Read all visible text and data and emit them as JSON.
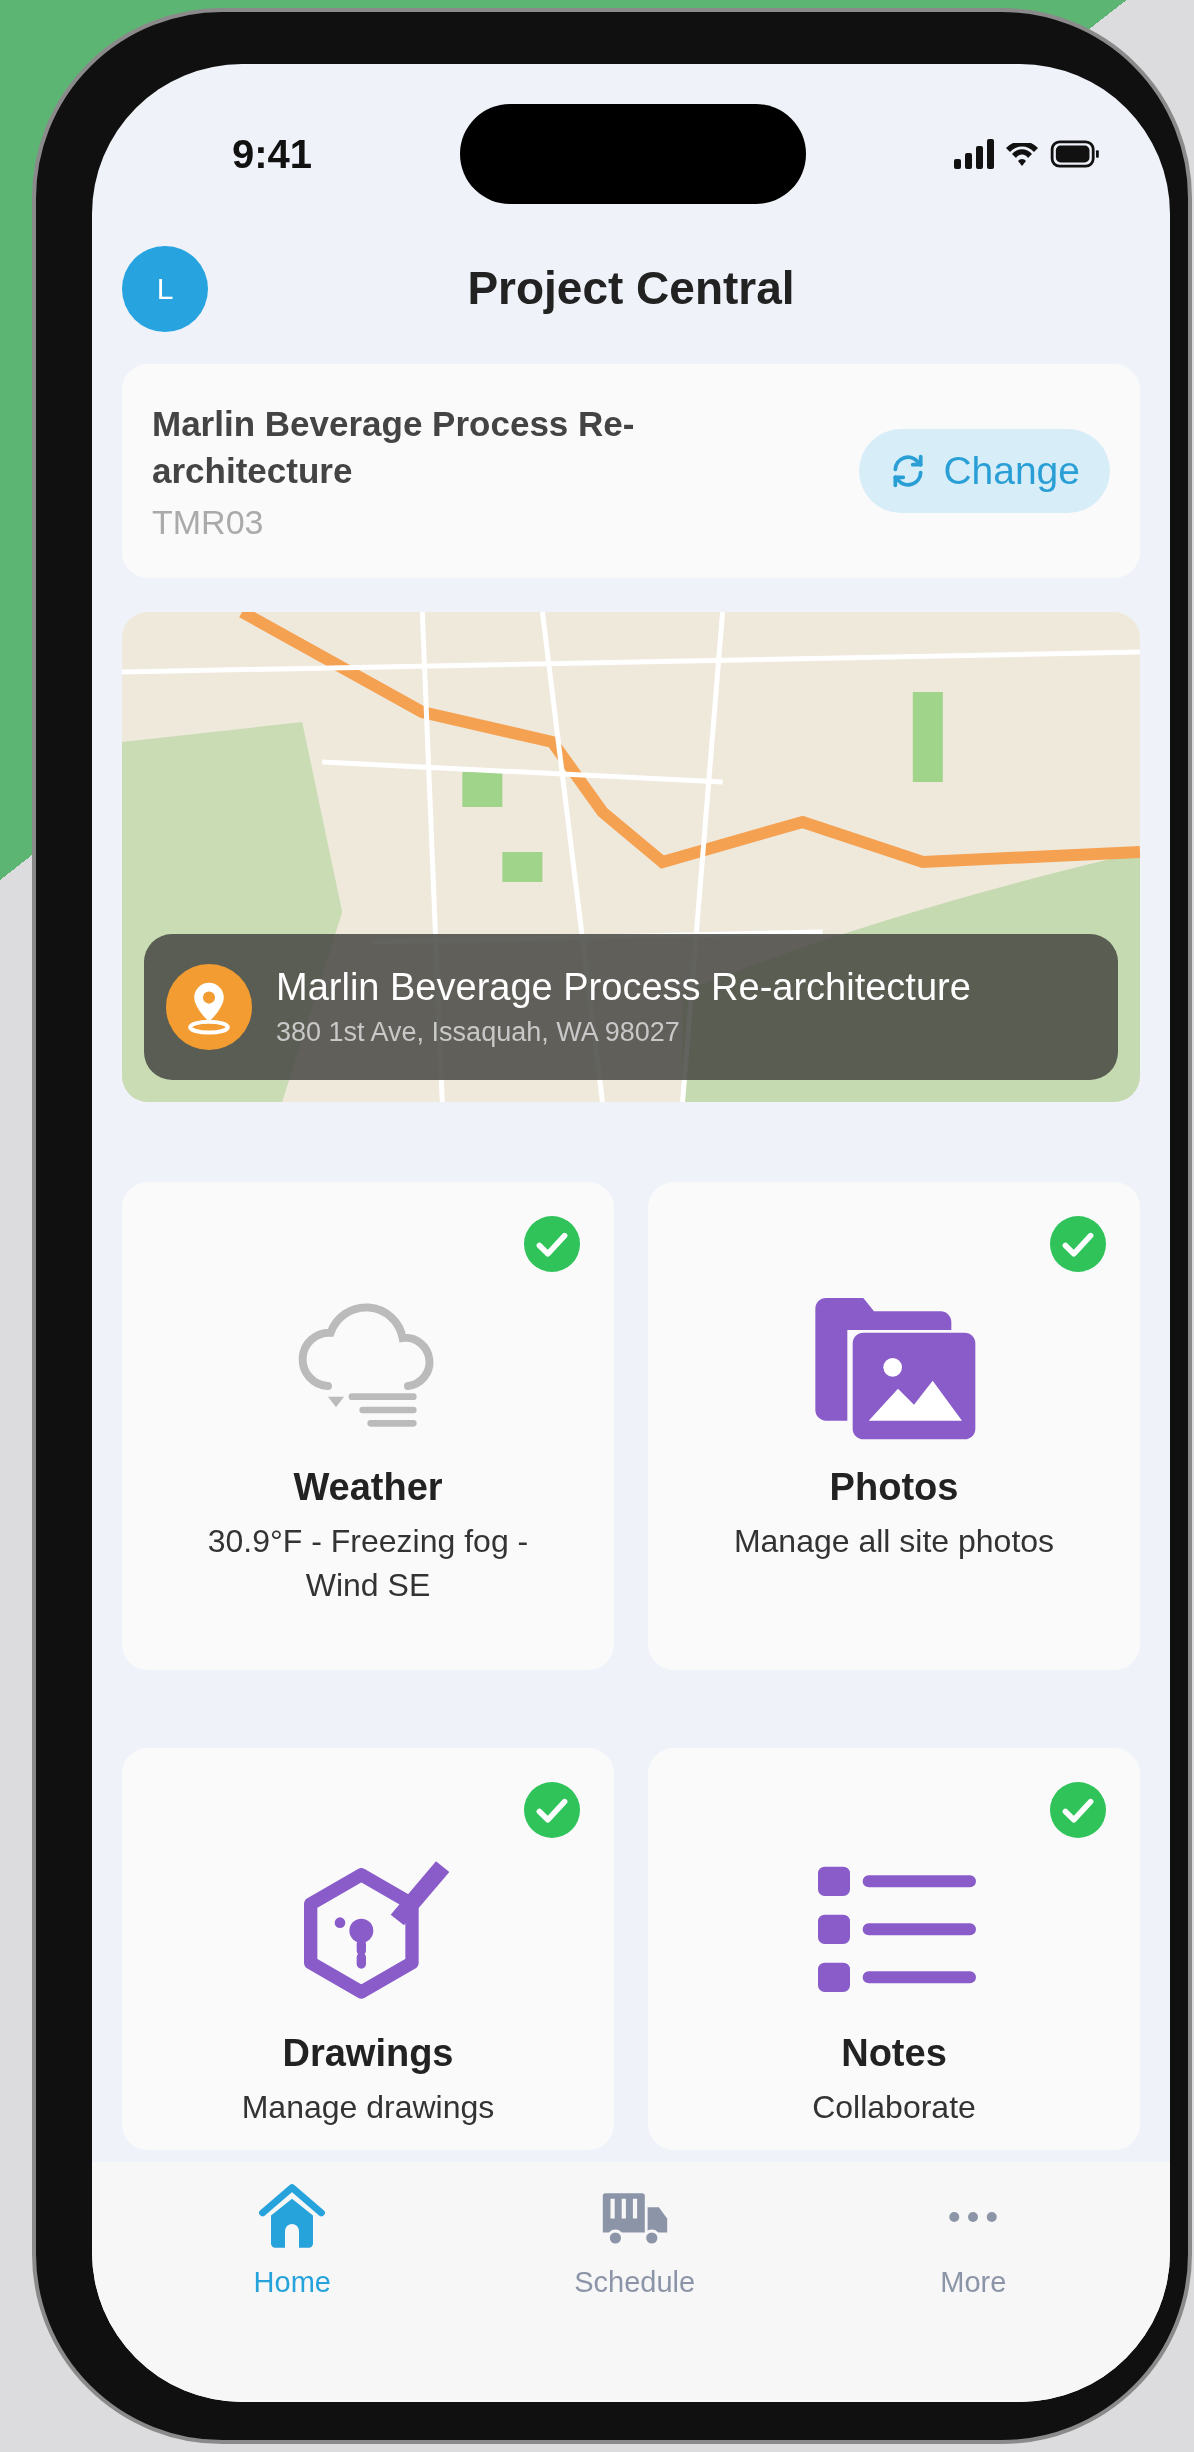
{
  "status_bar": {
    "time": "9:41"
  },
  "header": {
    "avatar_initial": "L",
    "title": "Project Central"
  },
  "project": {
    "name": "Marlin Beverage Process Re-architecture",
    "code": "TMR03",
    "change_button": "Change"
  },
  "map": {
    "location_name": "Marlin Beverage Process Re-architecture",
    "address": "380 1st Ave, Issaquah, WA 98027"
  },
  "tiles": [
    {
      "kind": "weather",
      "title": "Weather",
      "subtitle": "30.9°F - Freezing fog - Wind SE",
      "done": true
    },
    {
      "kind": "photos",
      "title": "Photos",
      "subtitle": "Manage all site photos",
      "done": true
    },
    {
      "kind": "drawings",
      "title": "Drawings",
      "subtitle": "Manage drawings",
      "done": true
    },
    {
      "kind": "notes",
      "title": "Notes",
      "subtitle": "Collaborate",
      "done": true
    }
  ],
  "nav": [
    {
      "kind": "home",
      "label": "Home",
      "selected": true
    },
    {
      "kind": "schedule",
      "label": "Schedule",
      "selected": false
    },
    {
      "kind": "more",
      "label": "More",
      "selected": false
    }
  ]
}
